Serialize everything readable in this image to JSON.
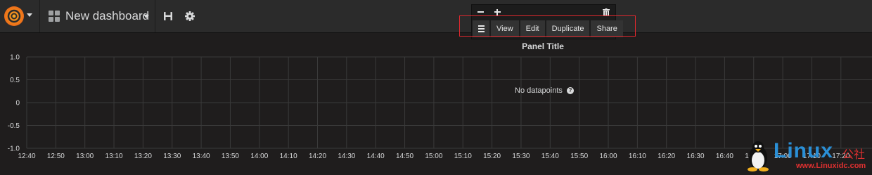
{
  "navbar": {
    "dashboard_title": "New dashboard"
  },
  "panel_menu": {
    "buttons": [
      "View",
      "Edit",
      "Duplicate",
      "Share"
    ]
  },
  "panel": {
    "title": "Panel Title",
    "no_data_text": "No datapoints"
  },
  "chart_data": {
    "type": "line",
    "title": "Panel Title",
    "y_ticks": [
      "1.0",
      "0.5",
      "0",
      "-0.5",
      "-1.0"
    ],
    "ylim": [
      -1.0,
      1.0
    ],
    "x_ticks": [
      "12:40",
      "12:50",
      "13:00",
      "13:10",
      "13:20",
      "13:30",
      "13:40",
      "13:50",
      "14:00",
      "14:10",
      "14:20",
      "14:30",
      "14:40",
      "14:50",
      "15:00",
      "15:10",
      "15:20",
      "15:30",
      "15:40",
      "15:50",
      "16:00",
      "16:10",
      "16:20",
      "16:30",
      "16:40",
      "16:50",
      "17:00",
      "17:10",
      "17:20"
    ],
    "series": [],
    "grid": true,
    "annotation": "No datapoints"
  },
  "watermark": {
    "text": "Linux",
    "chinese": "公社",
    "url": "www.Linuxidc.com"
  }
}
